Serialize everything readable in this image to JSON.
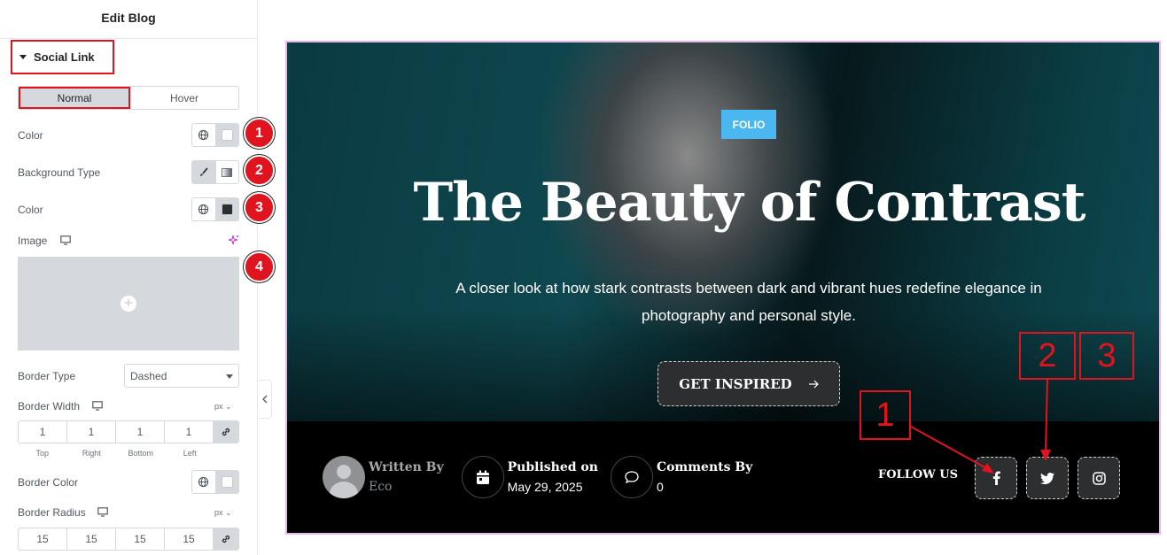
{
  "panel": {
    "title": "Edit Blog",
    "section_title": "Social Link",
    "tabs": {
      "normal": "Normal",
      "hover": "Hover"
    },
    "controls": {
      "color_label": "Color",
      "background_type_label": "Background Type",
      "bg_color_label": "Color",
      "image_label": "Image",
      "border_type_label": "Border Type",
      "border_type_value": "Dashed",
      "border_width_label": "Border Width",
      "border_width_unit": "px",
      "border_width_values": [
        "1",
        "1",
        "1",
        "1"
      ],
      "dimension_labels": [
        "Top",
        "Right",
        "Bottom",
        "Left"
      ],
      "border_color_label": "Border Color",
      "border_radius_label": "Border Radius",
      "border_radius_unit": "px",
      "border_radius_values": [
        "15",
        "15",
        "15",
        "15"
      ]
    },
    "badges": [
      "1",
      "2",
      "3",
      "4"
    ]
  },
  "preview": {
    "tag": "FOLIO",
    "title": "The Beauty of Contrast",
    "description": "A closer look at how stark contrasts between dark and vibrant hues redefine elegance in photography and personal style.",
    "cta_label": "GET INSPIRED",
    "meta": {
      "author_label": "Written By",
      "author_value": "Eco",
      "published_label": "Published on",
      "published_value": "May 29, 2025",
      "comments_label": "Comments By",
      "comments_value": "0"
    },
    "follow_label": "FOLLOW US",
    "social_icons": [
      "facebook-icon",
      "twitter-icon",
      "instagram-icon"
    ]
  },
  "annotations": [
    "1",
    "2",
    "3"
  ],
  "colors": {
    "accent_red": "#e0141e",
    "tag_blue": "#4ab7f0",
    "panel_border": "#d5d8dc",
    "preview_border": "#e5b7ec"
  }
}
